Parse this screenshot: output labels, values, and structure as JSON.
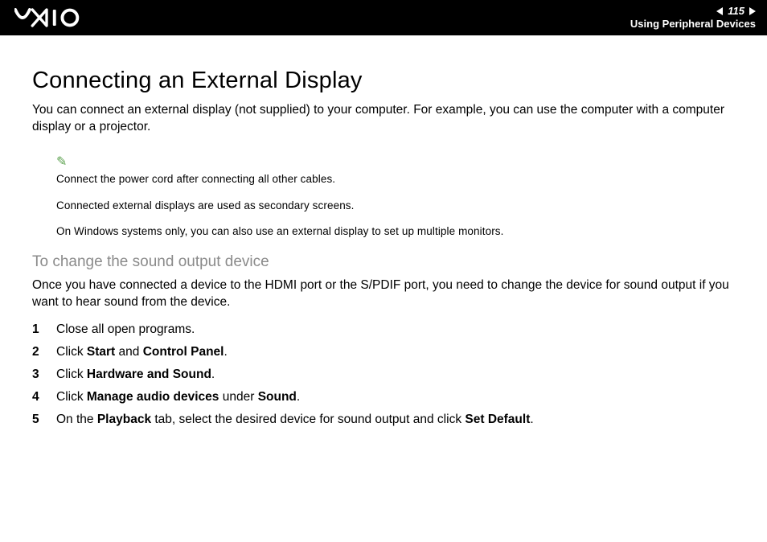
{
  "header": {
    "page_number": "115",
    "section": "Using Peripheral Devices"
  },
  "h1": "Connecting an External Display",
  "intro": "You can connect an external display (not supplied) to your computer. For example, you can use the computer with a computer display or a projector.",
  "notes": {
    "n1": "Connect the power cord after connecting all other cables.",
    "n2": "Connected external displays are used as secondary screens.",
    "n3": "On Windows systems only, you can also use an external display to set up multiple monitors."
  },
  "h2": "To change the sound output device",
  "p2": "Once you have connected a device to the HDMI port or the S/PDIF port, you need to change the device for sound output if you want to hear sound from the device.",
  "steps": {
    "s1": "Close all open programs.",
    "s2a": "Click ",
    "s2b": "Start",
    "s2c": " and ",
    "s2d": "Control Panel",
    "s2e": ".",
    "s3a": "Click ",
    "s3b": "Hardware and Sound",
    "s3c": ".",
    "s4a": "Click ",
    "s4b": "Manage audio devices",
    "s4c": " under ",
    "s4d": "Sound",
    "s4e": ".",
    "s5a": "On the ",
    "s5b": "Playback",
    "s5c": " tab, select the desired device for sound output and click ",
    "s5d": "Set Default",
    "s5e": "."
  }
}
